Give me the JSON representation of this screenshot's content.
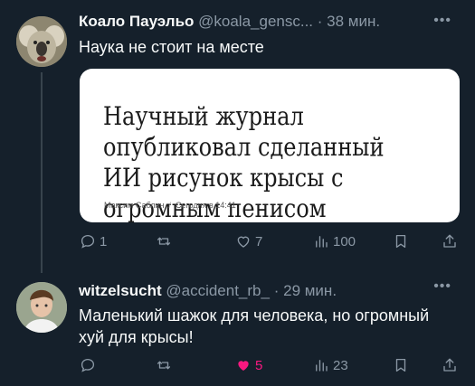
{
  "tweets": [
    {
      "author_name": "Коало Пауэльо",
      "handle": "@koala_gensc...",
      "time": "38 мин.",
      "text": "Наука не стоит на месте",
      "media": {
        "headline": "Научный журнал опубликовал сделанный ИИ рисунок крысы с огромным пенисом",
        "author": "Максим Саблин",
        "date": "Сегодня в 14:41"
      },
      "actions": {
        "replies": "1",
        "retweets": "",
        "likes": "7",
        "views": "100"
      },
      "liked": false
    },
    {
      "author_name": "witzelsucht",
      "handle": "@accident_rb_",
      "time": "29 мин.",
      "text": "Маленький шажок для человека, но огромный хуй для крысы!",
      "actions": {
        "replies": "",
        "retweets": "",
        "likes": "5",
        "views": "23"
      },
      "liked": true
    }
  ],
  "colors": {
    "background": "#15202b",
    "text_primary": "#f7f9f9",
    "text_secondary": "#8b98a5",
    "like_active": "#f91880"
  }
}
